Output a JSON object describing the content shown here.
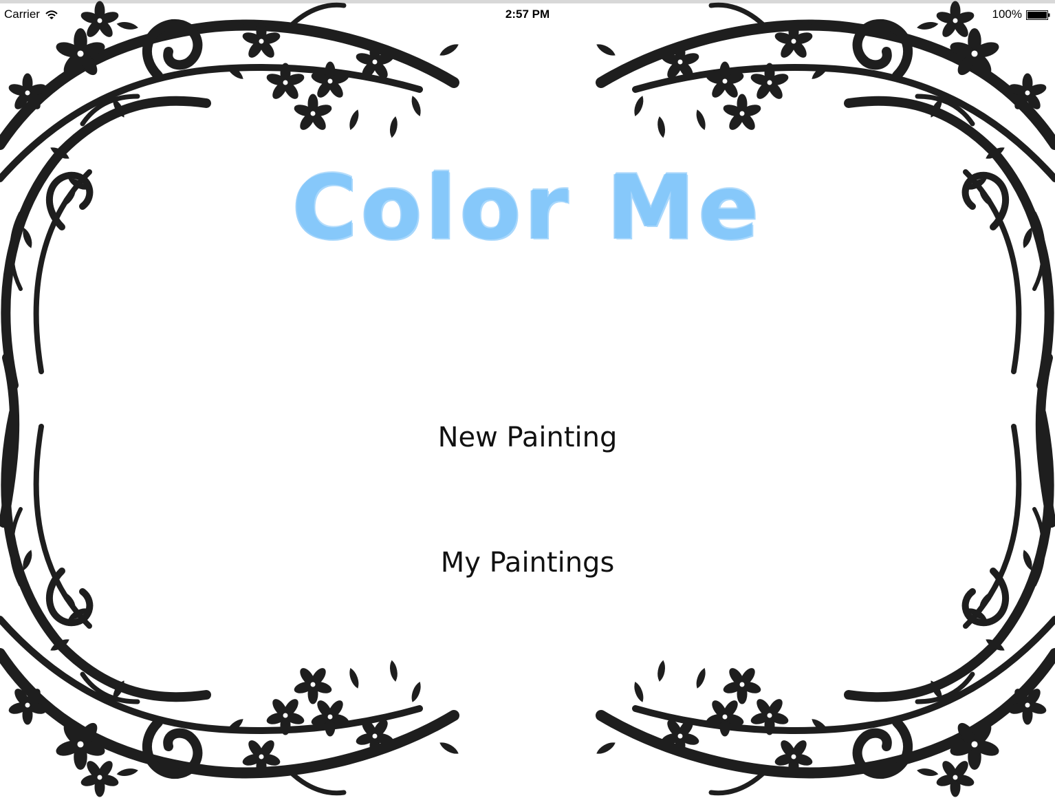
{
  "status_bar": {
    "carrier": "Carrier",
    "time": "2:57 PM",
    "battery_percent": "100%",
    "wifi_icon": "wifi-icon",
    "battery_icon": "battery-full-icon"
  },
  "app": {
    "title": "Color Me",
    "title_color": "#86c8fa"
  },
  "menu": {
    "new_painting_label": "New Painting",
    "my_paintings_label": "My Paintings"
  },
  "decoration": {
    "frame_color": "#1e1e1e",
    "motif": "floral-vine-frame"
  }
}
